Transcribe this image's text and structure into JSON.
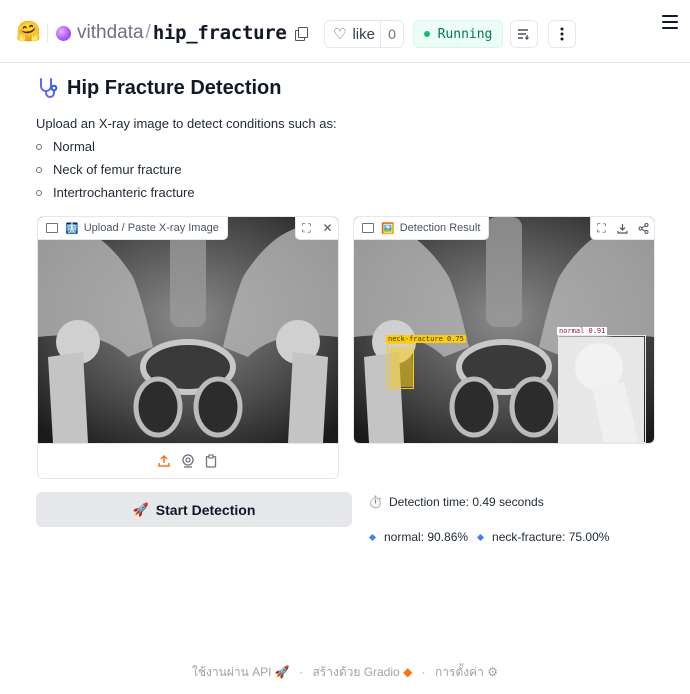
{
  "header": {
    "logo_icon": "hugging-face-logo",
    "owner": "vithdata",
    "separator": "/",
    "repo": "hip_fracture",
    "like_label": "like",
    "like_count": "0",
    "status": "Running",
    "status_color": "#10b981"
  },
  "main": {
    "title_icon": "stethoscope-icon",
    "title": "Hip Fracture Detection",
    "intro": "Upload an X-ray image to detect conditions such as:",
    "conditions": [
      "Normal",
      "Neck of femur fracture",
      "Intertrochanteric fracture"
    ]
  },
  "input_panel": {
    "label": "Upload / Paste X-ray Image",
    "label_emoji": "🩻"
  },
  "output_panel": {
    "label": "Detection Result",
    "label_emoji": "🖼️",
    "detections": [
      {
        "label": "neck-fracture 0.75",
        "color": "#facc15"
      },
      {
        "label": "normal 0.91",
        "color": "#e5e7eb"
      }
    ]
  },
  "actions": {
    "start_label": "Start Detection",
    "start_emoji": "🚀"
  },
  "results": {
    "time_emoji": "⏱️",
    "time_text": "Detection time: 0.49 seconds",
    "items": [
      "normal: 90.86%",
      "neck-fracture: 75.00%"
    ]
  },
  "footer": {
    "api": "ใช้งานผ่าน API",
    "built": "สร้างด้วย Gradio",
    "settings": "การตั้งค่า",
    "sep": "·"
  }
}
